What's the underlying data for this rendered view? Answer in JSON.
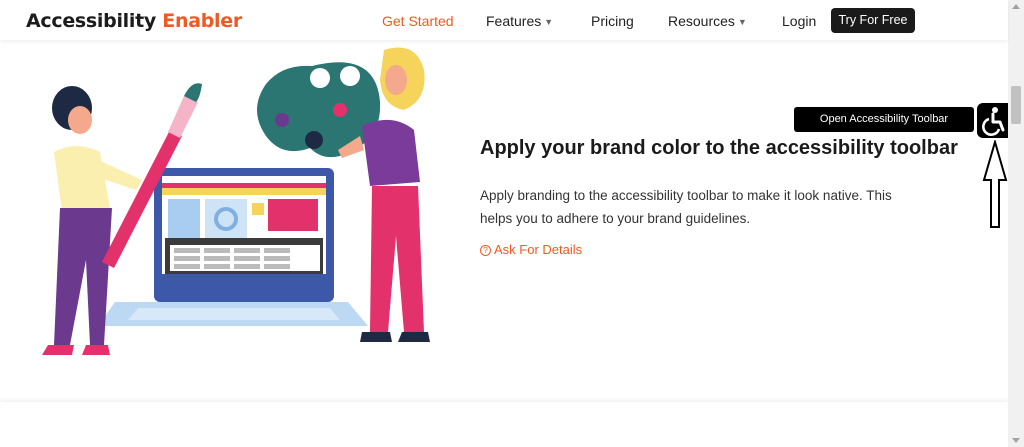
{
  "header": {
    "logo_main": "Accessibility",
    "logo_accent": "Enabler",
    "nav": {
      "get_started": "Get Started",
      "features": "Features",
      "pricing": "Pricing",
      "resources": "Resources",
      "login": "Login",
      "try_free": "Try For Free"
    }
  },
  "section": {
    "heading": "Apply your brand color to the accessibility toolbar",
    "description": "Apply branding to the accessibility toolbar to make it look native. This helps you to adhere to your brand guidelines.",
    "link": "Ask For Details"
  },
  "widget": {
    "tooltip": "Open Accessibility Toolbar",
    "icon": "wheelchair-icon"
  },
  "colors": {
    "accent": "#ef5a24",
    "dark": "#1a1a1a"
  }
}
